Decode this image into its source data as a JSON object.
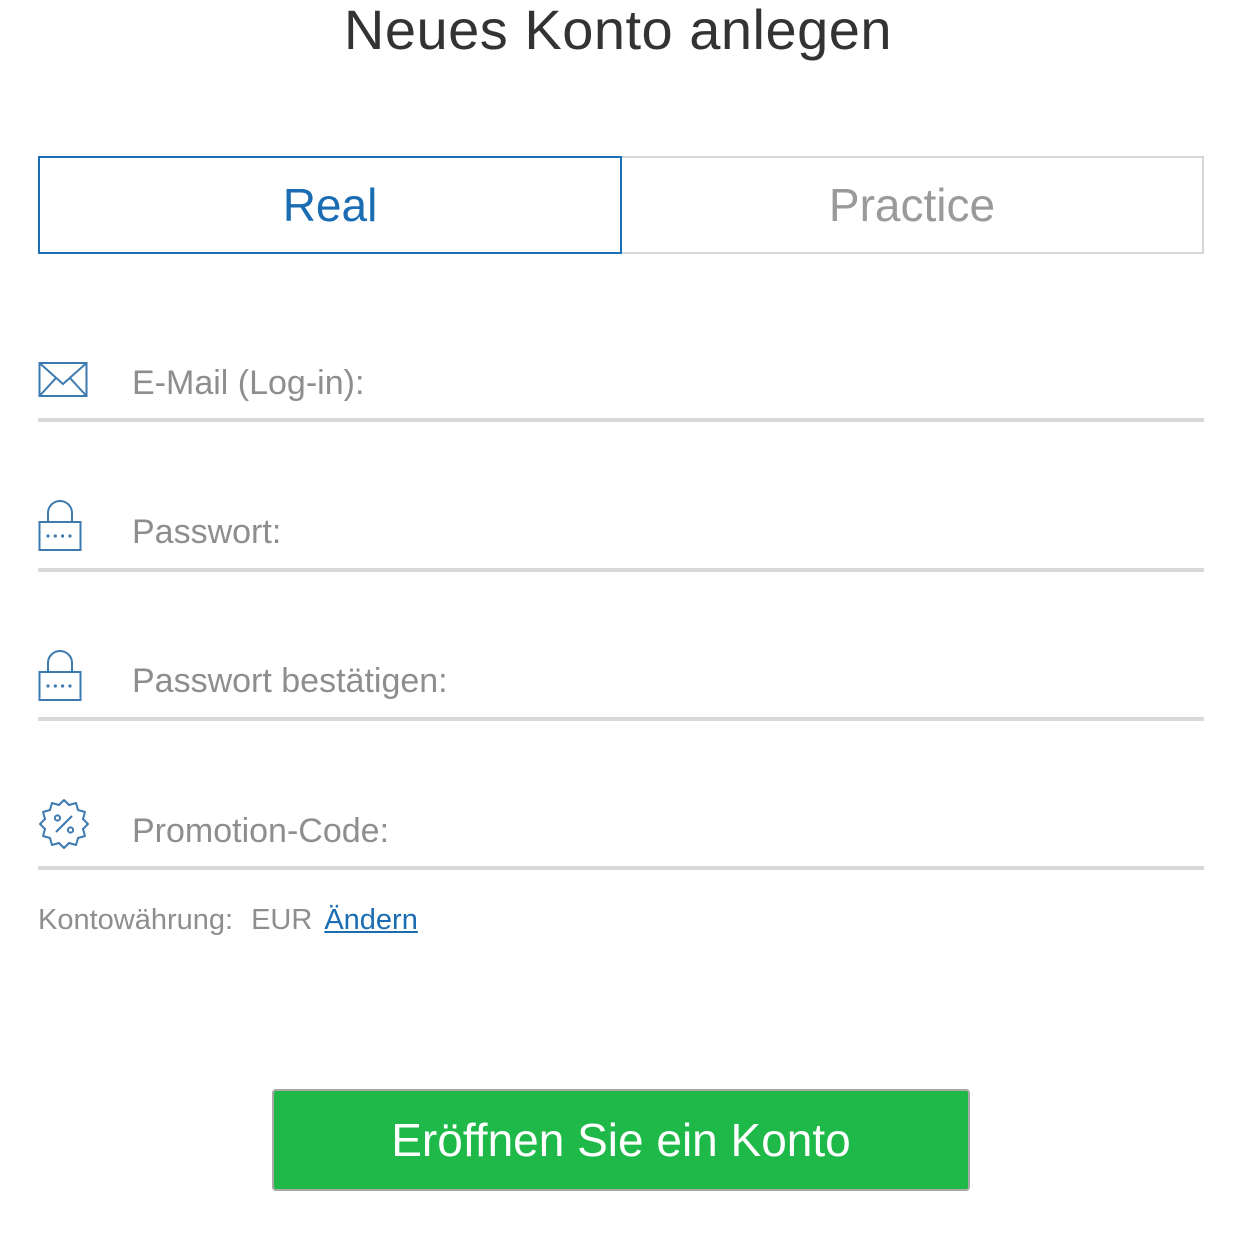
{
  "page": {
    "title": "Neues Konto anlegen"
  },
  "tabs": [
    {
      "label": "Real",
      "active": true
    },
    {
      "label": "Practice",
      "active": false
    }
  ],
  "fields": {
    "email": {
      "placeholder": "E-Mail (Log-in):",
      "value": "",
      "icon": "envelope-icon"
    },
    "password": {
      "placeholder": "Passwort:",
      "value": "",
      "icon": "lock-icon"
    },
    "password_confirm": {
      "placeholder": "Passwort bestätigen:",
      "value": "",
      "icon": "lock-icon"
    },
    "promo": {
      "placeholder": "Promotion-Code:",
      "value": "",
      "icon": "discount-badge-icon"
    }
  },
  "currency": {
    "label": "Kontowährung:",
    "code": "EUR",
    "change_link": "Ändern"
  },
  "submit": {
    "label": "Eröffnen Sie ein Konto"
  },
  "colors": {
    "accent_blue": "#1a6cb3",
    "button_green": "#1fb949",
    "icon_blue": "#3d7ab0",
    "muted_text": "#8e8e8e",
    "underline": "#d9d9d9"
  }
}
